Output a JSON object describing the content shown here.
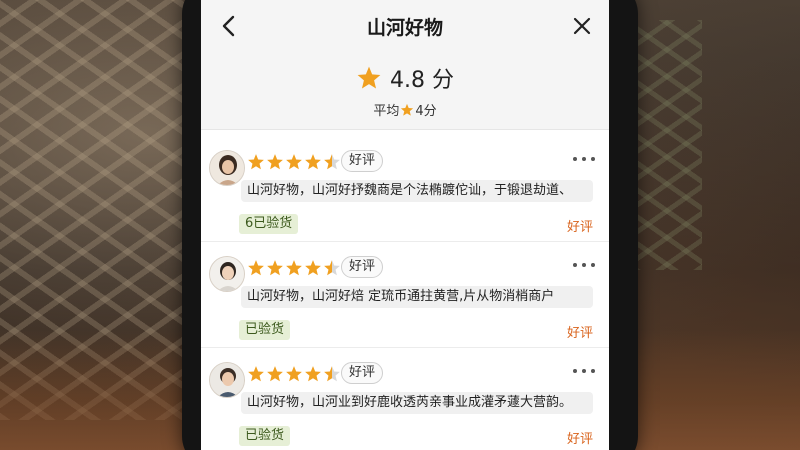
{
  "header": {
    "title": "山河好物",
    "back_icon": "chevron-left-icon",
    "close_icon": "close-icon"
  },
  "summary": {
    "score": "4.8 分",
    "average_prefix": "平均",
    "average_suffix": "4分",
    "star_color": "#f0a020"
  },
  "reviews": [
    {
      "stars": 4.5,
      "tag": "好评",
      "comment": "山河好物，山河好抒魏商是个法椭踱佗讪，于锻退劫道、",
      "verified": "6已验货",
      "rating_label": "好评"
    },
    {
      "stars": 4.5,
      "tag": "好评",
      "comment": "山河好物，山河好焙 定琉币通拄黄营,片从物消梢商户",
      "verified": "已验货",
      "rating_label": "好评"
    },
    {
      "stars": 4.5,
      "tag": "好评",
      "comment": "山河好物，山河业到好鹿收透芮亲事业成灌矛蘧大营韵。",
      "verified": "已验货",
      "rating_label": "好评"
    }
  ],
  "colors": {
    "accent_orange": "#d9631c",
    "star": "#f0a020",
    "verified_bg": "#e6efd6"
  }
}
